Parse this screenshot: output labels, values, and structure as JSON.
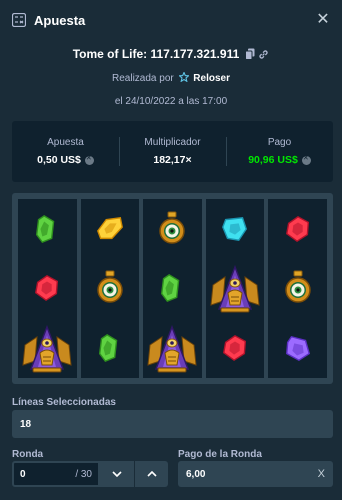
{
  "header": {
    "title": "Apuesta",
    "close_icon": "close-icon",
    "bet_icon": "bet-slip-icon"
  },
  "game": {
    "line": "Tome of Life: 117.177.321.911",
    "copy_icon": "copy-icon",
    "link_icon": "link-icon"
  },
  "placed": {
    "prefix": "Realizada por",
    "user": "Reloser",
    "user_icon": "vip-star-icon"
  },
  "date": "el 24/10/2022 a las 17:00",
  "stats": {
    "bet": {
      "label": "Apuesta",
      "value": "0,50 US$"
    },
    "multiplier": {
      "label": "Multiplicador",
      "value": "182,17×"
    },
    "payout": {
      "label": "Pago",
      "value": "90,96 US$"
    }
  },
  "reels": [
    [
      "green-gem",
      "red-gem",
      "pharaoh"
    ],
    [
      "yellow-gem",
      "eye-amulet",
      "green-gem"
    ],
    [
      "eye-amulet",
      "green-gem",
      "pharaoh"
    ],
    [
      "cyan-gem",
      "pharaoh",
      "red-gem"
    ],
    [
      "red-gem",
      "eye-amulet",
      "purple-gem"
    ]
  ],
  "lines": {
    "label": "Líneas Seleccionadas",
    "value": "18"
  },
  "round": {
    "label": "Ronda",
    "value": "0",
    "of": "/ 30"
  },
  "round_payout": {
    "label": "Pago de la Ronda",
    "value": "6,00",
    "clear": "X"
  },
  "colors": {
    "accent_green": "#00e701",
    "background": "#1a2c38",
    "panel": "#0f212e",
    "field": "#2f4553"
  }
}
